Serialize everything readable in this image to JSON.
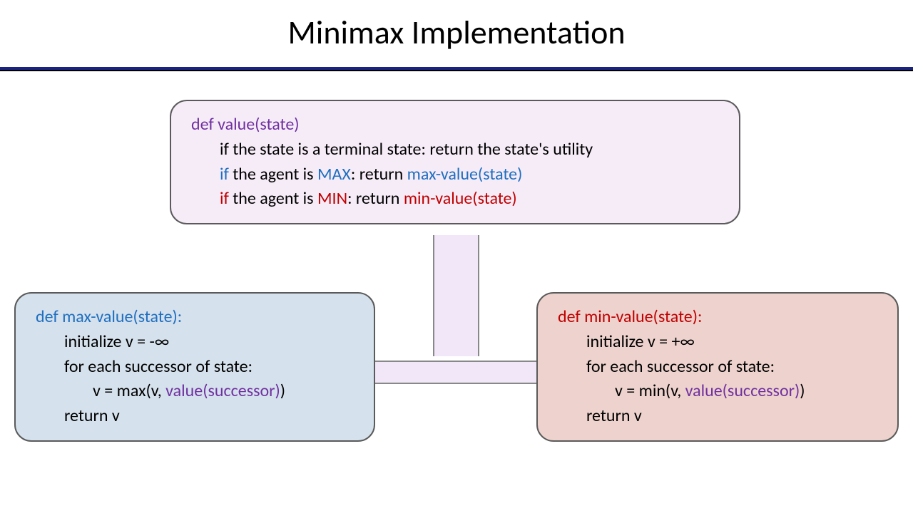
{
  "title": "Minimax Implementation",
  "box1": {
    "def": "def value(state)",
    "l1": "if the state is a terminal state: return the state's utility",
    "l2a": "if ",
    "l2b": "the agent is ",
    "l2c": "MAX",
    "l2d": ": return ",
    "l2e": "max-value(state)",
    "l3a": "if ",
    "l3b": "the agent is ",
    "l3c": "MIN",
    "l3d": ": return ",
    "l3e": "min-value(state)"
  },
  "box2": {
    "def": "def max-value(state):",
    "l1": "initialize v = -∞",
    "l2": "for each successor of state:",
    "l3a": "v = max(v, ",
    "l3b": "value(successor)",
    "l3c": ")",
    "l4": "return v"
  },
  "box3": {
    "def": "def min-value(state):",
    "l1": "initialize v = +∞",
    "l2": "for each successor of state:",
    "l3a": "v = min(v, ",
    "l3b": "value(successor)",
    "l3c": ")",
    "l4": "return v"
  }
}
